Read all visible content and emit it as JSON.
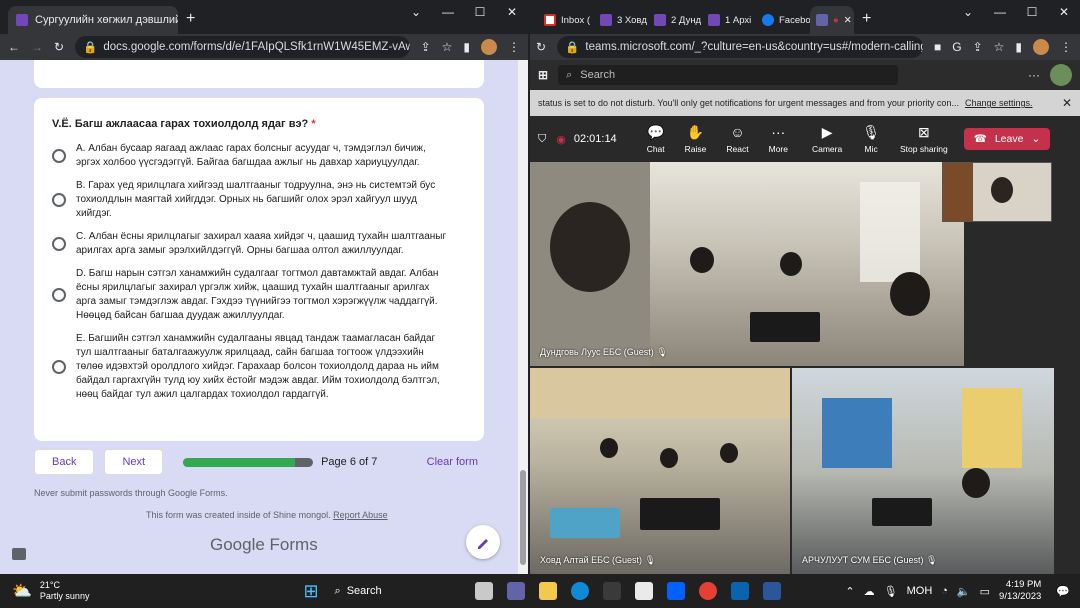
{
  "left_browser": {
    "tab_title": "Сургуулийн хөгжил дэвшлийн с",
    "url": "docs.google.com/forms/d/e/1FAIpQLSfk1rnW1W45EMZ-vAwkeV12...",
    "window_controls": [
      "⌄",
      "—",
      "☐",
      "✕"
    ]
  },
  "form": {
    "question": "V.Ё.  Багш ажлаасаа гарах тохиолдолд ядаг вэ?",
    "required_mark": "*",
    "options": [
      {
        "lines": [
          "А. Албан бусаар яагаад ажлаас гарах болсныг асуудаг ч, тэмдэглэл бичиж,",
          "эргэх холбоо үүсгэдэггүй. Байгаа багшдаа ажлыг нь давхар хариуцуулдаг."
        ]
      },
      {
        "lines": [
          "В. Гарах үед ярилцлага хийгээд шалтгааныг тодруулна, энэ нь системтэй бус",
          "тохиолдлын маягтай хийгддэг. Орных нь багшийг олох эрэл хайгуул шууд",
          "хийгдэг."
        ]
      },
      {
        "lines": [
          "С. Албан ёсны ярилцлагыг захирал хааяа хийдэг ч, цаашид тухайн шалтгааныг",
          "арилгах арга замыг эрэлхийлдэггүй. Орны багшаа олтол ажиллуулдаг."
        ]
      },
      {
        "lines": [
          "D. Багш нарын сэтгэл ханамжийн судалгааг тогтмол давтамжтай авдаг. Албан",
          "ёсны ярилцлагыг захирал үргэлж хийж, цаашид тухайн шалтгааныг арилгах",
          "арга замыг тэмдэглэж авдаг. Гэхдээ түүнийгээ тогтмол хэрэгжүүлж чаддаггүй.",
          "Нөөцөд байсан багшаа дуудаж ажиллуулдаг."
        ]
      },
      {
        "lines": [
          "Е. Багшийн сэтгэл ханамжийн судалгааны явцад тандаж таамагласан байдаг",
          "тул шалтгааныг баталгаажуулж ярилцаад, сайн багшаа тогтоож үлдээхийн",
          "төлөө идэвхтэй оролдлого хийдэг. Гарахаар болсон тохиолдолд дараа нь ийм",
          "байдал гаргахгүйн тулд юу хийх ёстойг мэдэж авдаг. Ийм тохиолдолд бэлтгэл,",
          "нөөц байдаг тул ажил цалгардах тохиолдол гардаггүй."
        ]
      }
    ],
    "back_label": "Back",
    "next_label": "Next",
    "progress_fraction": 0.857,
    "page_label": "Page 6 of 7",
    "clear_label": "Clear form",
    "note_passwords": "Never submit passwords through Google Forms.",
    "note_created": "This form was created inside of Shine mongol.",
    "report_abuse": "Report Abuse",
    "brand_google": "Google",
    "brand_forms": " Forms"
  },
  "right_browser": {
    "tabs": [
      "Inbox (",
      "3 Ховд",
      "2 Дунд",
      "1 Архі",
      "Facebo"
    ],
    "url": "teams.microsoft.com/_?culture=en-us&country=us#/modern-calling/",
    "window_controls": [
      "⌄",
      "—",
      "☐",
      "✕"
    ]
  },
  "teams": {
    "search_placeholder": "Search",
    "banner_text": "status is set to do not disturb. You'll only get notifications for urgent messages and from your priority con...",
    "banner_link": "Change settings.",
    "call_time": "02:01:14",
    "controls": [
      "Chat",
      "Raise",
      "React",
      "More",
      "Camera",
      "Mic",
      "Stop sharing"
    ],
    "leave_label": "Leave",
    "participants": [
      "Дундговь Луус ЕБС (Guest)",
      "Ховд Алтай ЕБС (Guest)",
      "АРЧУЛУУТ СУМ ЕБС (Guest)"
    ]
  },
  "taskbar": {
    "temperature": "21°C",
    "weather": "Partly sunny",
    "search_label": "Search",
    "language": "МОН",
    "time": "4:19 PM",
    "date": "9/13/2023"
  },
  "colors": {
    "form_accent": "#673ab7",
    "progress_green": "#34a853",
    "leave_red": "#c4314b"
  }
}
